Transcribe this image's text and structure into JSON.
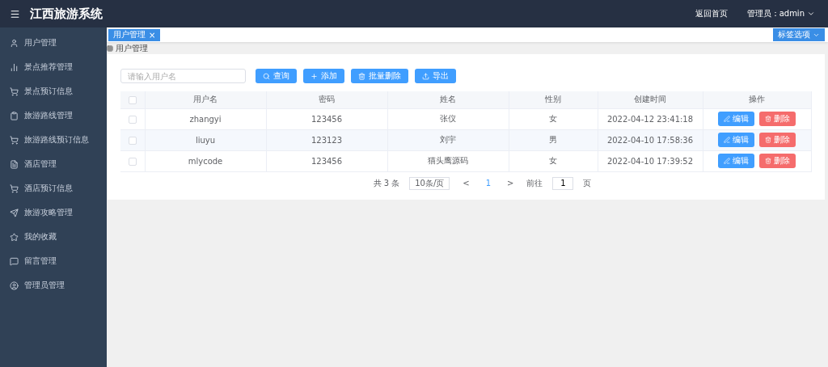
{
  "header": {
    "title": "江西旅游系统",
    "links": [
      "返回首页"
    ],
    "user": "管理员：admin"
  },
  "sidebar": {
    "items": [
      {
        "label": "用户管理"
      },
      {
        "label": "景点推荐管理"
      },
      {
        "label": "景点预订信息"
      },
      {
        "label": "旅游路线管理"
      },
      {
        "label": "旅游路线预订信息"
      },
      {
        "label": "酒店管理"
      },
      {
        "label": "酒店预订信息"
      },
      {
        "label": "旅游攻略管理"
      },
      {
        "label": "我的收藏"
      },
      {
        "label": "留言管理"
      },
      {
        "label": "管理员管理"
      }
    ]
  },
  "tabs": [
    {
      "label": "用户管理",
      "close": "×",
      "selected": true
    }
  ],
  "tab_options": "标签选项",
  "breadcrumb": "用户管理",
  "search": {
    "placeholder": "请输入用户名"
  },
  "toolbar": [
    {
      "label": "查询"
    },
    {
      "label": "添加"
    },
    {
      "label": "批量删除"
    },
    {
      "label": "导出"
    }
  ],
  "table": {
    "select_all_checked": false,
    "columns": [
      "用户名",
      "密码",
      "姓名",
      "性别",
      "创建时间",
      "操作"
    ],
    "rows": [
      {
        "checked": false,
        "cells": [
          "zhangyi",
          "123456",
          "张仪",
          "女",
          "2022-04-12 23:41:18"
        ],
        "actions": [
          "编辑",
          "删除"
        ]
      },
      {
        "checked": false,
        "cells": [
          "liuyu",
          "123123",
          "刘宇",
          "男",
          "2022-04-10 17:58:36"
        ],
        "actions": [
          "编辑",
          "删除"
        ]
      },
      {
        "checked": false,
        "cells": [
          "mlycode",
          "123456",
          "猫头鹰源码",
          "女",
          "2022-04-10 17:39:52"
        ],
        "actions": [
          "编辑",
          "删除"
        ]
      }
    ]
  },
  "pagination": {
    "total": "共 3 条",
    "page_size": "10条/页",
    "prev": "<",
    "pages": [
      {
        "label": "1",
        "selected": true
      }
    ],
    "next": ">",
    "goto": "前往",
    "goto_value": "1",
    "suffix": "页"
  }
}
